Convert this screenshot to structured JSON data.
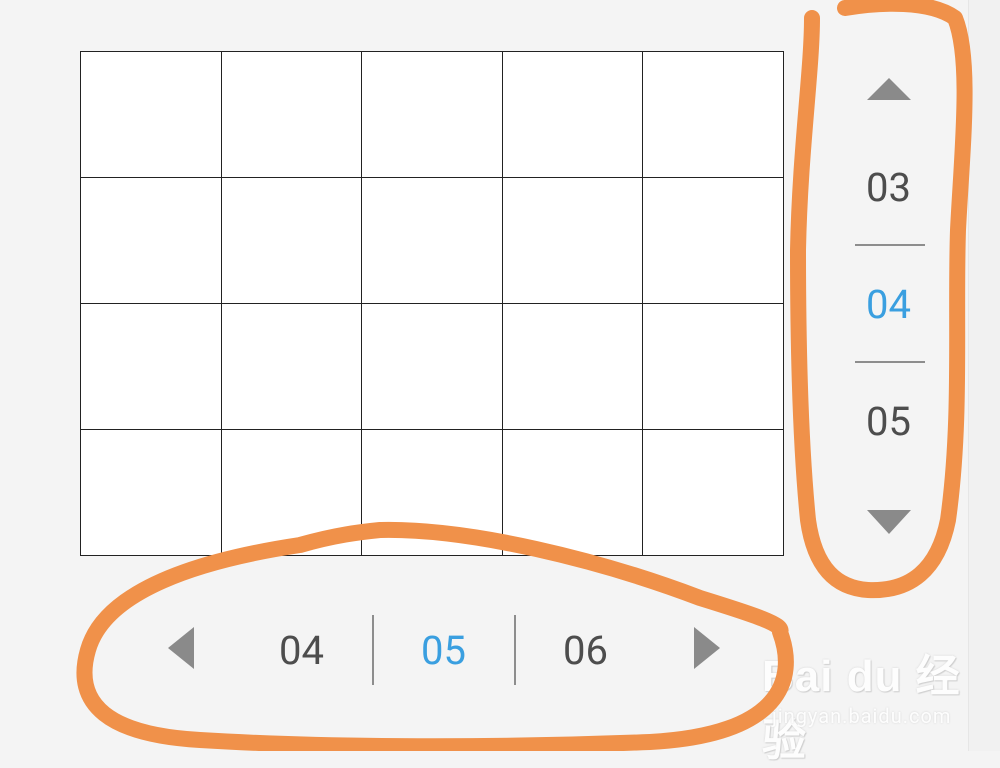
{
  "vertical_picker": {
    "items": [
      "03",
      "04",
      "05"
    ],
    "selected": "04"
  },
  "horizontal_picker": {
    "items": [
      "04",
      "05",
      "06"
    ],
    "selected": "05"
  },
  "watermark": {
    "logo_text": "Bai du 经验",
    "url": "jingyan.baidu.com"
  },
  "colors": {
    "selected": "#3a9fe0",
    "number": "#4d4d4d",
    "arrow": "#8a8a8a",
    "annotation": "#f0914a"
  }
}
